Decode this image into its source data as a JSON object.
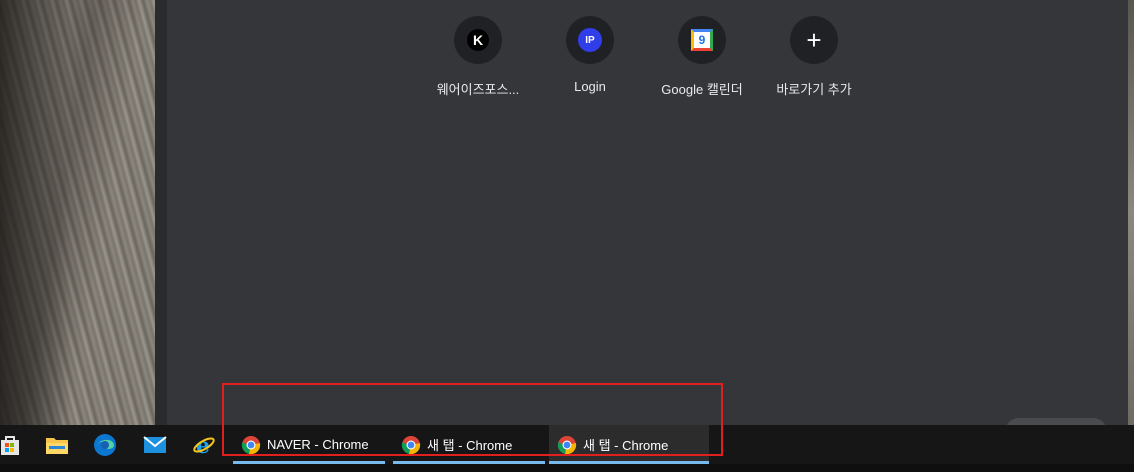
{
  "shortcuts": [
    {
      "label": "웨어이즈포스...",
      "icon": "k-letter-icon",
      "glyph": "K"
    },
    {
      "label": "Login",
      "icon": "ip-letter-icon",
      "glyph": "IP"
    },
    {
      "label": "Google 캘린더",
      "icon": "google-calendar-icon",
      "glyph": "9"
    },
    {
      "label": "바로가기 추가",
      "icon": "plus-icon",
      "glyph": "+"
    }
  ],
  "taskbar": {
    "pinned": [
      "store-icon",
      "file-explorer-icon",
      "edge-icon",
      "mail-icon",
      "internet-explorer-icon"
    ],
    "windows": [
      {
        "label": "NAVER - Chrome",
        "active": false
      },
      {
        "label": "새 탭 - Chrome",
        "active": false
      },
      {
        "label": "새 탭 - Chrome",
        "active": true
      }
    ]
  },
  "colors": {
    "browser_bg": "#35363a",
    "tile_bg": "#202124",
    "taskbar_bg": "#161616",
    "highlight_box": "#e0201f",
    "taskbar_underline": "#76b9ed"
  }
}
